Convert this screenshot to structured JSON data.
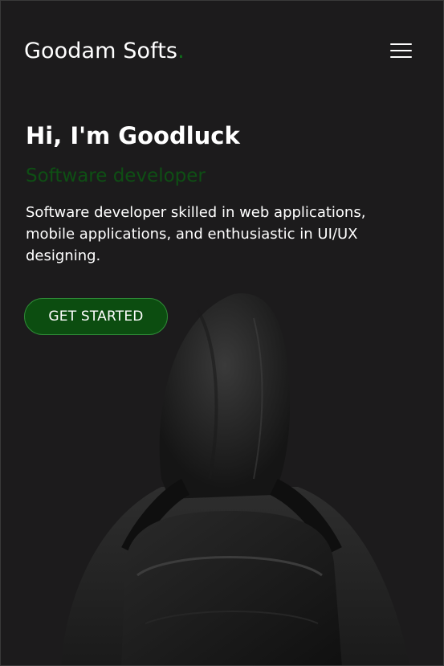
{
  "header": {
    "brand": "Goodam Softs",
    "brand_dot": "."
  },
  "hero": {
    "title": "Hi, I'm Goodluck",
    "role": "Software developer",
    "description": "Software developer skilled in web applications, mobile applications, and enthusiastic in UI/UX designing.",
    "cta_label": "GET STARTED"
  },
  "icons": {
    "menu": "hamburger-menu-icon"
  },
  "colors": {
    "background": "#1c1b1c",
    "accent": "#0c4d10",
    "role_text": "#0e4f14"
  }
}
